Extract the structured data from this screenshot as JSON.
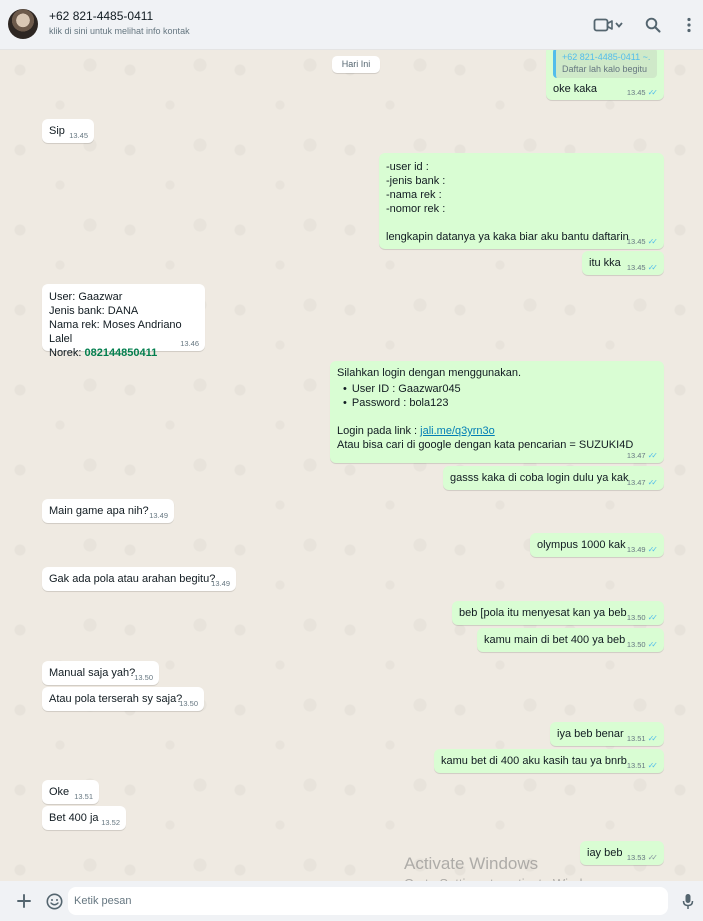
{
  "header": {
    "contact_name": "+62 821-4485-0411",
    "contact_sub": "klik di sini untuk melihat info kontak"
  },
  "day_label": "Hari Ini",
  "messages": [
    {
      "dir": "out",
      "quote_name": "+62 821-4485-0411",
      "quote_tilde": "~.",
      "quote_text": "Daftar lah kalo begitu",
      "text": "oke kaka",
      "time": "13.45",
      "read": true
    },
    {
      "dir": "in",
      "text": "Sip",
      "time": "13.45"
    },
    {
      "dir": "out",
      "text": "-user id :\n-jenis bank :\n-nama rek :\n-nomor rek :\n\nlengkapin datanya ya kaka biar aku bantu daftarin",
      "time": "13.45",
      "read": true
    },
    {
      "dir": "out",
      "text": "itu kka",
      "time": "13.45",
      "read": true
    },
    {
      "dir": "in",
      "text": "User: Gaazwar\nJenis bank: DANA\nNama rek: Moses Andriano Lalel\nNorek: ",
      "number": "082144850411",
      "time": "13.46"
    },
    {
      "dir": "out",
      "intro": "Silahkan login dengan menggunakan.",
      "bullets": [
        "User ID : Gaazwar045",
        "Password : bola123"
      ],
      "login_label": "Login pada link : ",
      "link": "jali.me/q3yrn3o",
      "after": "Atau bisa cari di google dengan kata pencarian = SUZUKI4D",
      "time": "13.47",
      "read": true
    },
    {
      "dir": "out",
      "text": "gasss kaka di coba login dulu ya kak",
      "time": "13.47",
      "read": true
    },
    {
      "dir": "in",
      "text": "Main game apa nih?",
      "time": "13.49"
    },
    {
      "dir": "out",
      "text": "olympus 1000 kak",
      "time": "13.49",
      "read": true
    },
    {
      "dir": "in",
      "text": "Gak ada pola atau arahan begitu?",
      "time": "13.49"
    },
    {
      "dir": "out",
      "text": "beb [pola itu menyesat kan ya beb",
      "time": "13.50",
      "read": true
    },
    {
      "dir": "out",
      "text": "kamu main di bet 400 ya beb",
      "time": "13.50",
      "read": true
    },
    {
      "dir": "in",
      "text": "Manual saja yah?",
      "time": "13.50"
    },
    {
      "dir": "in",
      "text": "Atau pola terserah sy saja?",
      "time": "13.50"
    },
    {
      "dir": "out",
      "text": "iya beb benar",
      "time": "13.51",
      "read": true
    },
    {
      "dir": "out",
      "text": "kamu bet di 400 aku kasih tau ya bnrb",
      "time": "13.51",
      "read": true
    },
    {
      "dir": "in",
      "text": "Oke",
      "time": "13.51"
    },
    {
      "dir": "in",
      "text": "Bet 400 ja",
      "time": "13.52"
    },
    {
      "dir": "out",
      "text": "iay beb",
      "time": "13.53",
      "read": false
    }
  ],
  "composer": {
    "placeholder": "Ketik pesan"
  },
  "watermark": {
    "line1": "Activate Windows",
    "line2": "Go to Settings to activate Windows."
  },
  "icons": [
    "video-call-icon",
    "search-icon",
    "menu-icon",
    "plus-icon",
    "emoji-icon",
    "microphone-icon"
  ],
  "colors": {
    "outgoing_bubble": "#d9fdd3",
    "incoming_bubble": "#ffffff",
    "read_ticks": "#53bdeb",
    "chat_background": "#efeae2"
  }
}
